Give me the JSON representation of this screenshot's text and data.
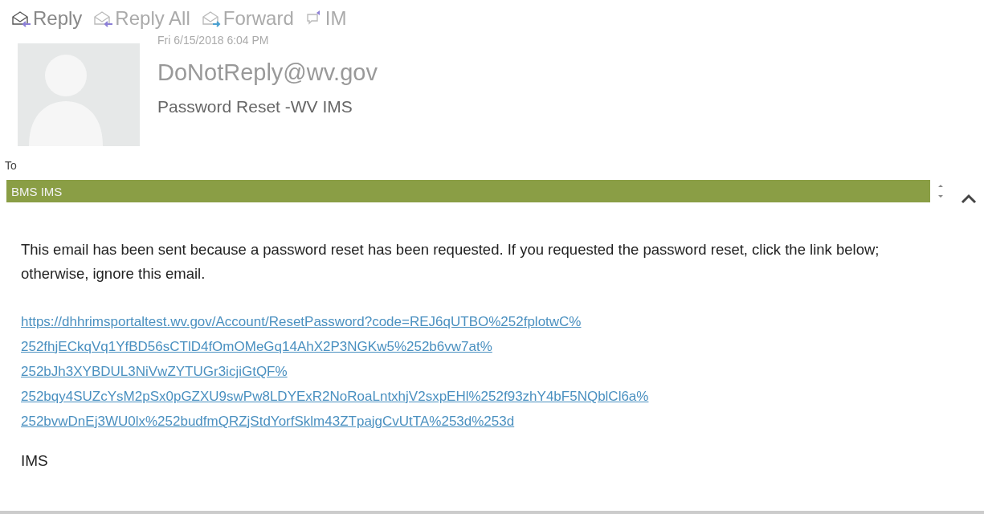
{
  "toolbar": [
    {
      "label": "Reply",
      "kind": "reply"
    },
    {
      "label": "Reply All",
      "kind": "reply-all"
    },
    {
      "label": "Forward",
      "kind": "forward"
    },
    {
      "label": "IM",
      "kind": "im"
    }
  ],
  "header": {
    "date": "Fri 6/15/2018 6:04 PM",
    "sender": "DoNotReply@wv.gov",
    "subject": "Password Reset -WV IMS"
  },
  "to": {
    "label": "To",
    "recipients": [
      "BMS IMS"
    ]
  },
  "body": {
    "paragraph": "This email has been sent because a password reset has been requested. If you requested the password reset, click the link below; otherwise, ignore this email.",
    "link_lines": [
      "https://dhhrimsportaltest.wv.gov/Account/ResetPassword?code=REJ6qUTBO%252fplotwC%",
      "252fhjECkqVq1YfBD56sCTlD4fOmOMeGq14AhX2P3NGKw5%252b6vw7at%",
      "252bJh3XYBDUL3NiVwZYTUGr3icjiGtQF%",
      "252bqy4SUZcYsM2pSx0pGZXU9swPw8LDYExR2NoRoaLntxhjV2sxpEHl%252f93zhY4bF5NQblCl6a%",
      "252bvwDnEj3WU0lx%252budfmQRZjStdYorfSklm43ZTpajgCvUtTA%253d%253d"
    ],
    "signature": "IMS"
  }
}
